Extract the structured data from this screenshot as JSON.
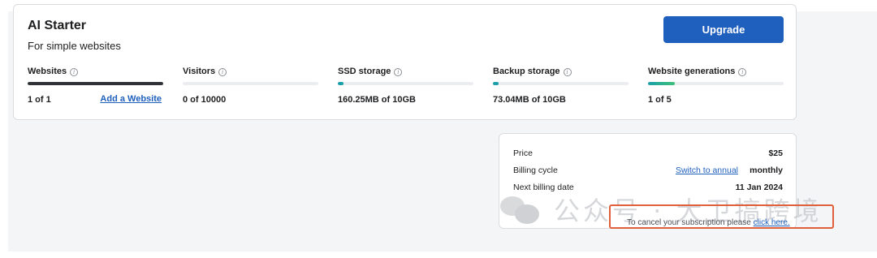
{
  "plan": {
    "name": "AI Starter",
    "subtitle": "For simple websites",
    "upgrade_label": "Upgrade"
  },
  "metrics": [
    {
      "title": "Websites",
      "value": "1 of 1",
      "usage": 1.0,
      "bar_color": "#2f3237",
      "link": "Add a Website"
    },
    {
      "title": "Visitors",
      "value": "0 of 10000",
      "usage": 0.0,
      "bar_color": "#1aa0a8"
    },
    {
      "title": "SSD storage",
      "value": "160.25MB of 10GB",
      "usage": 0.0157,
      "bar_color": "#1aa0a8"
    },
    {
      "title": "Backup storage",
      "value": "73.04MB of 10GB",
      "usage": 0.0071,
      "bar_color": "#1aa0a8"
    },
    {
      "title": "Website generations",
      "value": "1 of 5",
      "usage": 0.2,
      "bar_color": "#1aa0a8"
    }
  ],
  "billing": {
    "price_label": "Price",
    "price_value": "$25",
    "cycle_label": "Billing cycle",
    "cycle_link": "Switch to annual",
    "cycle_value": "monthly",
    "next_label": "Next billing date",
    "next_value": "11 Jan 2024"
  },
  "cancel": {
    "text": "To cancel your subscription please ",
    "link": "click here."
  },
  "watermark": {
    "text": "公众号 · 大卫搞跨境"
  },
  "colors": {
    "accent": "#1f5fbd",
    "highlight": "#e0603c"
  },
  "icons": {
    "info": "info-circle-icon",
    "watermark_logo": "wechat-icon"
  }
}
